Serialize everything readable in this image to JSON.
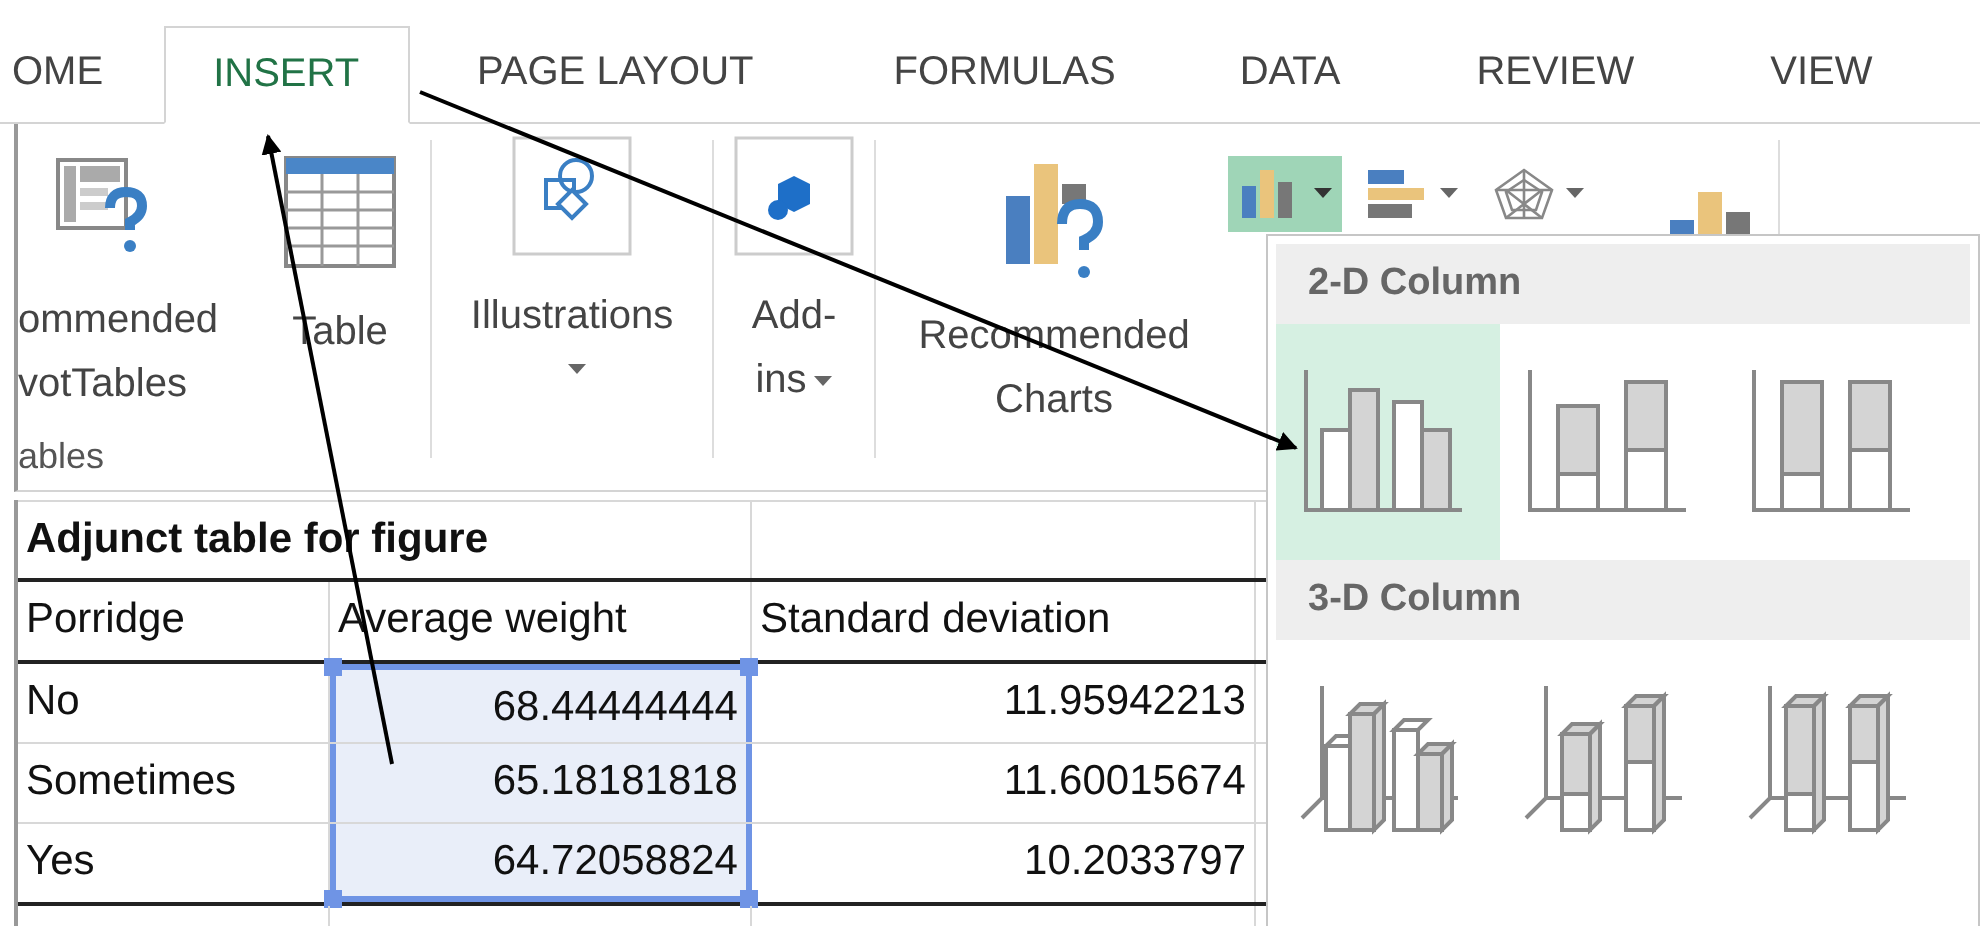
{
  "tabs": [
    {
      "label": "OME",
      "selected": false
    },
    {
      "label": "INSERT",
      "selected": true
    },
    {
      "label": "PAGE LAYOUT",
      "selected": false
    },
    {
      "label": "FORMULAS",
      "selected": false
    },
    {
      "label": "DATA",
      "selected": false
    },
    {
      "label": "REVIEW",
      "selected": false
    },
    {
      "label": "VIEW",
      "selected": false
    }
  ],
  "ribbon": {
    "groups": [
      {
        "label": "ables",
        "buttons": [
          {
            "kind": "pivot",
            "lines": [
              "ommended",
              "votTables"
            ],
            "dropdown": false
          },
          {
            "kind": "table",
            "lines": [
              "Table"
            ],
            "dropdown": false
          }
        ]
      },
      {
        "buttons": [
          {
            "kind": "illustrations",
            "lines": [
              "Illustrations"
            ],
            "dropdown": true
          }
        ]
      },
      {
        "buttons": [
          {
            "kind": "addins",
            "lines": [
              "Add-",
              "ins"
            ],
            "dropdown": true
          }
        ]
      },
      {
        "buttons": [
          {
            "kind": "charts",
            "lines": [
              "Recommended",
              "Charts"
            ],
            "dropdown": false
          }
        ]
      }
    ],
    "chart_buttons": [
      {
        "kind": "column",
        "selected": true
      },
      {
        "kind": "bar",
        "selected": false
      },
      {
        "kind": "radar",
        "selected": false
      }
    ]
  },
  "sheet": {
    "title": "Adjunct table for figure",
    "columns": [
      "Porridge",
      "Average weight",
      "Standard deviation"
    ],
    "rows": [
      {
        "cells": [
          {
            "text": "No",
            "selected": false
          },
          {
            "text": "68.44444444",
            "selected": true
          },
          {
            "text": "11.95942213",
            "selected": false
          }
        ]
      },
      {
        "cells": [
          {
            "text": "Sometimes",
            "selected": false
          },
          {
            "text": "65.18181818",
            "selected": true
          },
          {
            "text": "11.60015674",
            "selected": false
          }
        ]
      },
      {
        "cells": [
          {
            "text": "Yes",
            "selected": false
          },
          {
            "text": "64.72058824",
            "selected": true
          },
          {
            "text": "10.2033797",
            "selected": false
          }
        ]
      }
    ]
  },
  "dropdown": {
    "sections": [
      {
        "title": "2-D Column",
        "items": [
          {
            "kind": "clustered",
            "selected": true
          },
          {
            "kind": "stacked",
            "selected": false
          },
          {
            "kind": "stacked100",
            "selected": false
          }
        ]
      },
      {
        "title": "3-D Column",
        "items": [
          {
            "kind": "clustered3d",
            "selected": false
          },
          {
            "kind": "stacked3d",
            "selected": false
          },
          {
            "kind": "stacked100_3d",
            "selected": false
          }
        ]
      }
    ]
  }
}
